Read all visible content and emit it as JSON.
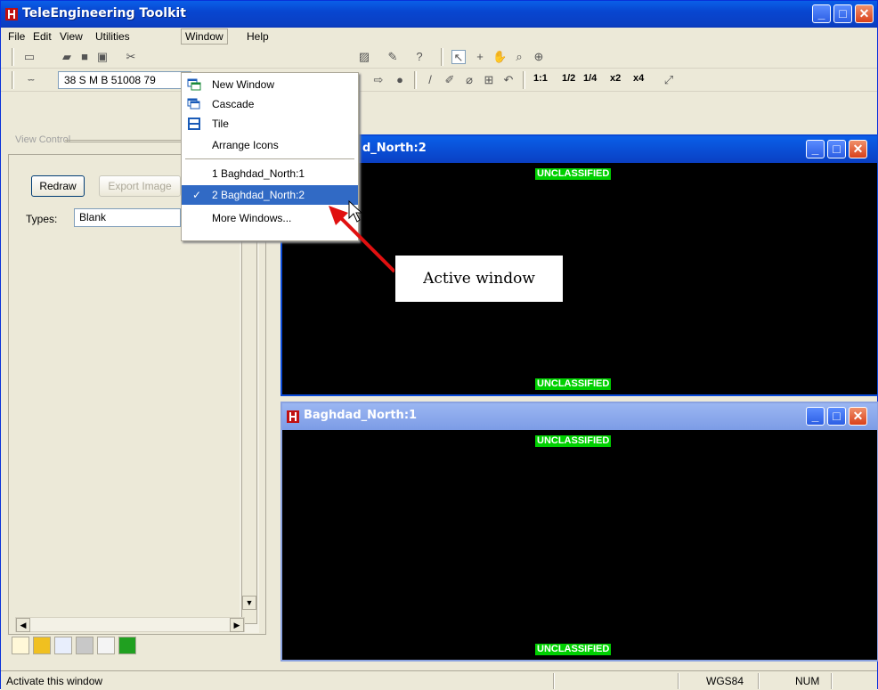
{
  "app": {
    "title": "TeleEngineering Toolkit"
  },
  "menubar": {
    "items": [
      "File",
      "Edit",
      "View",
      "Utilities",
      "Window",
      "Help"
    ]
  },
  "toolbar2": {
    "coord_value": "38 S M B 51008 79",
    "ratio_labels": [
      "1:1",
      "1/2",
      "1/4",
      "x2",
      "x4"
    ]
  },
  "view_control": {
    "header": "View Control",
    "redraw_label": "Redraw",
    "export_label": "Export Image",
    "types_label": "Types:",
    "types_value": "Blank"
  },
  "window_menu": {
    "items": [
      {
        "label": "New Window",
        "icon": "new-window-icon"
      },
      {
        "label": "Cascade",
        "icon": "cascade-icon"
      },
      {
        "label": "Tile",
        "icon": "tile-icon"
      },
      {
        "label": "Arrange Icons",
        "icon": ""
      },
      {
        "label": "1 Baghdad_North:1",
        "icon": ""
      },
      {
        "label": "2 Baghdad_North:2",
        "icon": "checkmark-icon",
        "selected": true
      },
      {
        "label": "More Windows...",
        "icon": ""
      }
    ]
  },
  "child_windows": [
    {
      "title": "Baghdad_North:2",
      "title_visible": "d_North:2",
      "banner_top": "UNCLASSIFIED",
      "banner_bottom": "UNCLASSIFIED",
      "active": true
    },
    {
      "title": "Baghdad_North:1",
      "banner_top": "UNCLASSIFIED",
      "banner_bottom": "UNCLASSIFIED",
      "active": false
    }
  ],
  "annotation": {
    "callout": "Active window"
  },
  "statusbar": {
    "message": "Activate this window",
    "datum": "WGS84",
    "num": "NUM"
  },
  "colors": {
    "titlebar": "#0a4ad6",
    "menu_highlight": "#316ac5",
    "banner": "#00d000",
    "callout_arrow": "#e01010"
  }
}
